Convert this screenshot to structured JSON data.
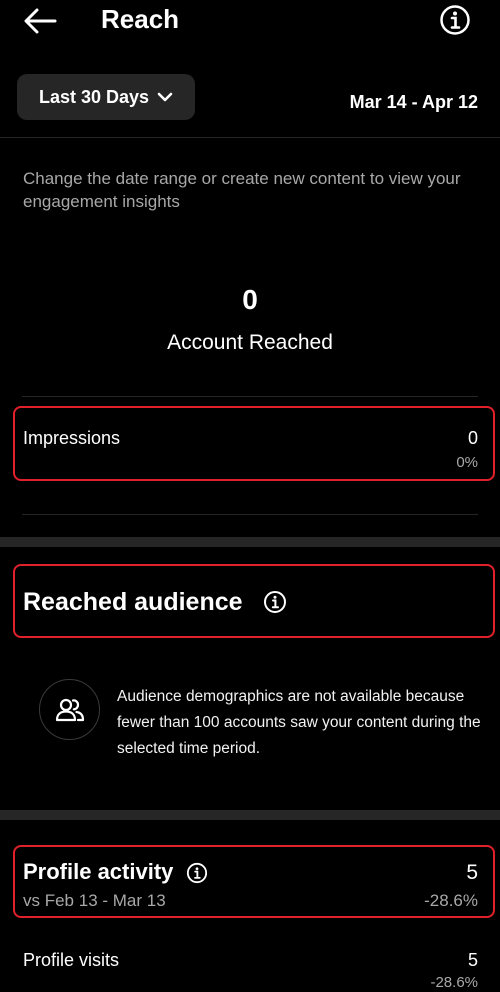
{
  "header": {
    "title": "Reach",
    "back_icon": "arrow-left-icon",
    "info_icon": "info-icon"
  },
  "range": {
    "selector_label": "Last 30 Days",
    "date_range": "Mar 14 - Apr 12"
  },
  "hint": "Change the date range or create new content to view your engagement insights",
  "reach": {
    "number": "0",
    "label": "Account Reached"
  },
  "impressions": {
    "label": "Impressions",
    "value": "0",
    "pct": "0%"
  },
  "audience": {
    "title": "Reached audience",
    "message": "Audience demographics are not available because fewer than 100 accounts saw your content during the selected time period."
  },
  "profile_activity": {
    "title": "Profile activity",
    "value": "5",
    "compare": "vs Feb 13 - Mar 13",
    "change": "-28.6%"
  },
  "profile_visits": {
    "label": "Profile visits",
    "value": "5",
    "change": "-28.6%"
  },
  "colors": {
    "background": "#000000",
    "text": "#ffffff",
    "secondary_text": "#a8a8a8",
    "button_bg": "#262626",
    "highlight_border": "#e0202b"
  }
}
